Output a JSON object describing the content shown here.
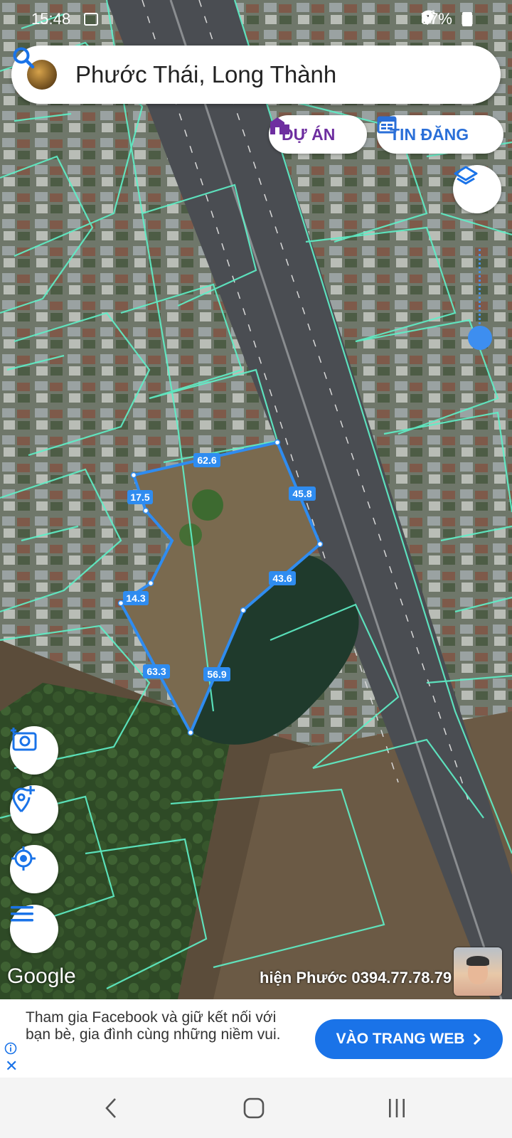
{
  "status_bar": {
    "time": "15:48",
    "battery": "57%"
  },
  "search": {
    "query": "Phước Thái, Long Thành"
  },
  "chips": {
    "du_an": "DỰ ÁN",
    "tin_dang": "TIN ĐĂNG"
  },
  "plot_measurements": [
    "62.6",
    "45.8",
    "17.5",
    "43.6",
    "14.3",
    "63.3",
    "56.9"
  ],
  "map": {
    "attribution": "Google",
    "watermark": "hiện Phước 0394.77.78.79"
  },
  "ad": {
    "text": "Tham gia Facebook và giữ kết nối với bạn bè, gia đình cùng những niềm vui.",
    "cta": "VÀO TRANG WEB"
  },
  "colors": {
    "parcel_lines": "#5ff0c8",
    "plot_outline": "#2f8cf0",
    "accent": "#1a73e8",
    "du_an": "#6e2ea0"
  },
  "icons": [
    "image-icon",
    "location-icon",
    "wifi-icon",
    "signal-icon",
    "battery-icon",
    "search-icon",
    "building-icon",
    "news-icon",
    "layers-icon",
    "camera-add-icon",
    "add-place-icon",
    "my-location-icon",
    "menu-icon",
    "info-icon",
    "close-icon",
    "chevron-right-icon",
    "back-icon",
    "home-icon",
    "recents-icon"
  ]
}
